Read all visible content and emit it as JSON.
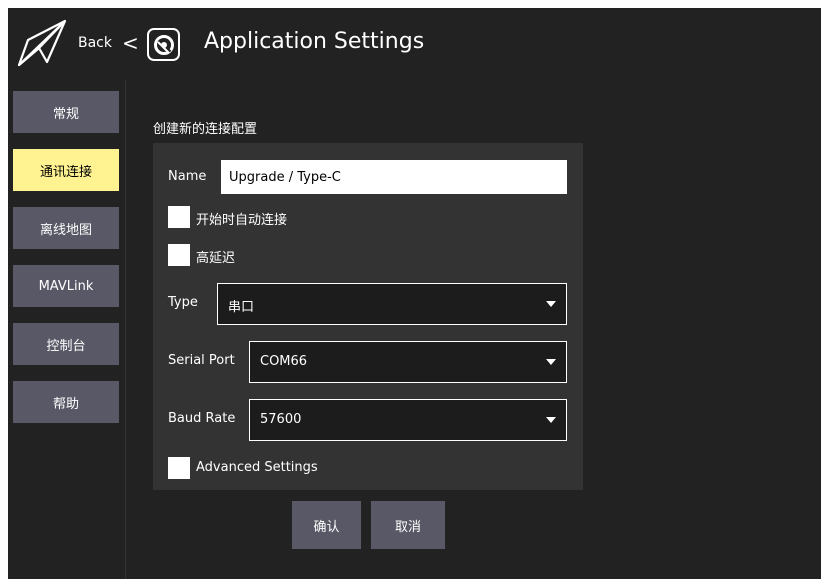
{
  "header": {
    "back_label": "Back",
    "chevron": "<",
    "title": "Application Settings",
    "back_icon": "paper-plane-icon",
    "settings_icon": "qgc-logo-icon"
  },
  "sidebar": {
    "items": [
      {
        "label": "常规",
        "active": false
      },
      {
        "label": "通讯连接",
        "active": true
      },
      {
        "label": "离线地图",
        "active": false
      },
      {
        "label": "MAVLink",
        "active": false
      },
      {
        "label": "控制台",
        "active": false
      },
      {
        "label": "帮助",
        "active": false
      }
    ]
  },
  "form": {
    "section_title": "创建新的连接配置",
    "name_label": "Name",
    "name_value": "Upgrade / Type-C",
    "auto_connect_label": "开始时自动连接",
    "high_latency_label": "高延迟",
    "type_label": "Type",
    "type_value": "串口",
    "serial_port_label": "Serial Port",
    "serial_port_value": "COM66",
    "baud_rate_label": "Baud Rate",
    "baud_rate_value": "57600",
    "advanced_label": "Advanced Settings"
  },
  "actions": {
    "confirm_label": "确认",
    "cancel_label": "取消"
  },
  "colors": {
    "background": "#222222",
    "panel": "#333333",
    "button": "#585866",
    "active_button": "#fff291"
  }
}
